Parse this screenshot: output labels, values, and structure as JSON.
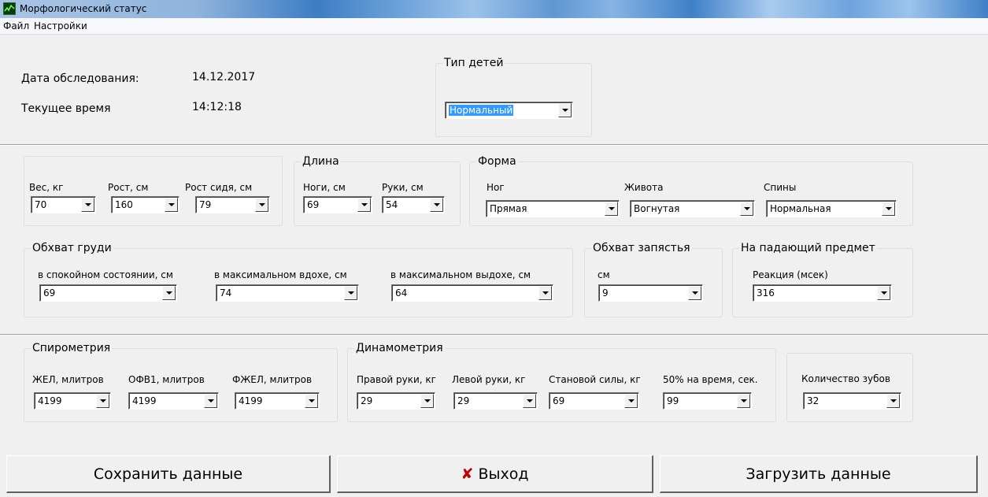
{
  "window": {
    "title": "Морфологический статус",
    "icon": "app-chart-icon"
  },
  "menu": [
    "Файл",
    "Настройки"
  ],
  "exam": {
    "date_label": "Дата обследования:",
    "date_value": "14.12.2017",
    "time_label": "Текущее время",
    "time_value": "14:12:18"
  },
  "child_type": {
    "legend": "Тип детей",
    "value": "Нормальный"
  },
  "body": {
    "weight": {
      "label": "Вес, кг",
      "value": "70"
    },
    "height": {
      "label": "Рост, см",
      "value": "160"
    },
    "sitting_height": {
      "label": "Рост сидя, см",
      "value": "79"
    }
  },
  "length": {
    "legend": "Длина",
    "legs": {
      "label": "Ноги, см",
      "value": "69"
    },
    "arms": {
      "label": "Руки, см",
      "value": "54"
    }
  },
  "shape": {
    "legend": "Форма",
    "legs": {
      "label": "Ног",
      "value": "Прямая"
    },
    "belly": {
      "label": "Живота",
      "value": "Вогнутая"
    },
    "back": {
      "label": "Спины",
      "value": "Нормальная"
    }
  },
  "chest": {
    "legend": "Обхват груди",
    "rest": {
      "label": "в спокойном состоянии, см",
      "value": "69"
    },
    "inhale": {
      "label": "в максимальном вдохе, см",
      "value": "74"
    },
    "exhale": {
      "label": "в максимальном выдохе, см",
      "value": "64"
    }
  },
  "wrist": {
    "legend": "Обхват запястья",
    "label": "см",
    "value": "9"
  },
  "falling": {
    "legend": "На падающий предмет",
    "label": "Реакция (мсек)",
    "value": "316"
  },
  "spirometry": {
    "legend": "Спирометрия",
    "zhel": {
      "label": "ЖЕЛ, млитров",
      "value": "4199"
    },
    "ofv1": {
      "label": "ОФВ1, млитров",
      "value": "4199"
    },
    "fzhel": {
      "label": "ФЖЕЛ, млитров",
      "value": "4199"
    }
  },
  "dynamometry": {
    "legend": "Динамометрия",
    "right": {
      "label": "Правой руки, кг",
      "value": "29"
    },
    "left": {
      "label": "Левой руки, кг",
      "value": "29"
    },
    "back": {
      "label": "Становой силы, кг",
      "value": "69"
    },
    "time50": {
      "label": "50% на время, сек.",
      "value": "99"
    }
  },
  "teeth": {
    "label": "Количество зубов",
    "value": "32"
  },
  "buttons": {
    "save": "Сохранить данные",
    "exit": "Выход",
    "load": "Загрузить данные"
  },
  "colors": {
    "title_bar": "#3d7dc4",
    "selection": "#3399ff",
    "exit_icon": "#c00000"
  }
}
